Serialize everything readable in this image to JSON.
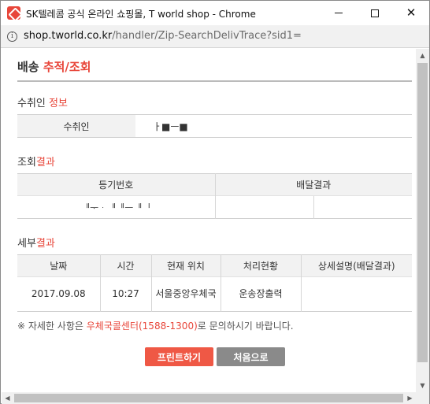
{
  "window": {
    "title": "SK텔레콤 공식 온라인 쇼핑몰, T world shop - Chrome",
    "minimize_glyph": "",
    "maximize_glyph": "",
    "close_glyph": "✕"
  },
  "address": {
    "host": "shop.tworld.co.kr",
    "path": "/handler/Zip-SearchDelivTrace?sid1="
  },
  "page": {
    "title_part1": "배송 ",
    "title_part2": "추적/조회"
  },
  "recipient": {
    "section_part1": "수취인 ",
    "section_part2": "정보",
    "label": "수취인",
    "value": "ㅏ■ㅡ■"
  },
  "result": {
    "section_part1": "조회",
    "section_part2": "결과",
    "headers": [
      "등기번호",
      "배달결과"
    ],
    "tracking_number": "ᅵᅵᅮᆞᅵᅵᅵᅵᅳᅵᅵᅵ",
    "delivery_result_1": "",
    "delivery_result_2": ""
  },
  "detail": {
    "section_part1": "세부",
    "section_part2": "결과",
    "headers": [
      "날짜",
      "시간",
      "현재 위치",
      "처리현황",
      "상세설명(배달결과)"
    ],
    "rows": [
      {
        "date": "2017.09.08",
        "time": "10:27",
        "location": "서울중앙우체국",
        "status": "운송장출력",
        "description": ""
      }
    ]
  },
  "notice": {
    "prefix": "※ 자세한 사항은 ",
    "link": "우체국콜센터(1588-1300)",
    "suffix": "로 문의하시기 바랍니다."
  },
  "buttons": {
    "print": "프린트하기",
    "home": "처음으로"
  },
  "colors": {
    "accent": "#e8463a",
    "print_button": "#ef5845",
    "home_button": "#8a8a8a"
  }
}
